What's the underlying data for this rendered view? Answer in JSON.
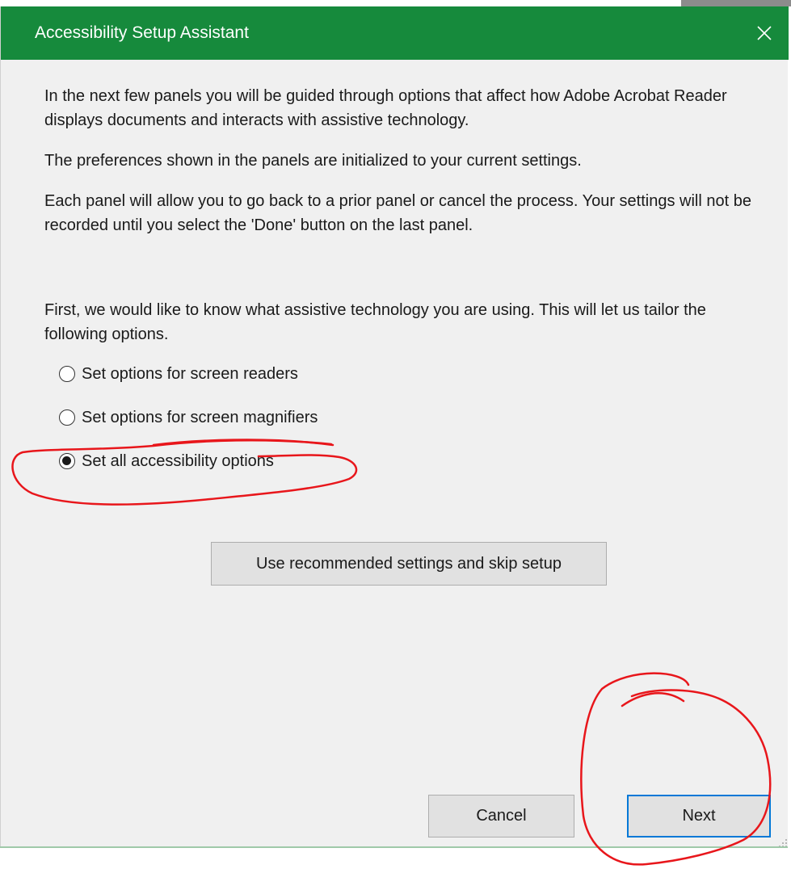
{
  "window": {
    "title": "Accessibility Setup Assistant",
    "close_icon": "close-icon",
    "titlebar_color": "#168a3c"
  },
  "intro": {
    "paragraph1": "In the next few panels you will be guided through options that affect how Adobe Acrobat Reader displays documents and interacts with assistive technology.",
    "paragraph2": "The preferences shown in the panels are initialized to your current settings.",
    "paragraph3": "Each panel will allow you to go back to a prior panel or cancel the process. Your settings will not be recorded until you select the 'Done' button on the last panel.",
    "question": "First, we would like to know what assistive technology you are using. This will let us tailor the following options."
  },
  "options": {
    "items": [
      {
        "label": "Set options for screen readers",
        "checked": false
      },
      {
        "label": "Set options for screen magnifiers",
        "checked": false
      },
      {
        "label": "Set all accessibility options",
        "checked": true
      }
    ]
  },
  "buttons": {
    "skip_label": "Use recommended settings and skip setup",
    "cancel_label": "Cancel",
    "next_label": "Next"
  },
  "annotation": {
    "color": "#e8161b"
  }
}
